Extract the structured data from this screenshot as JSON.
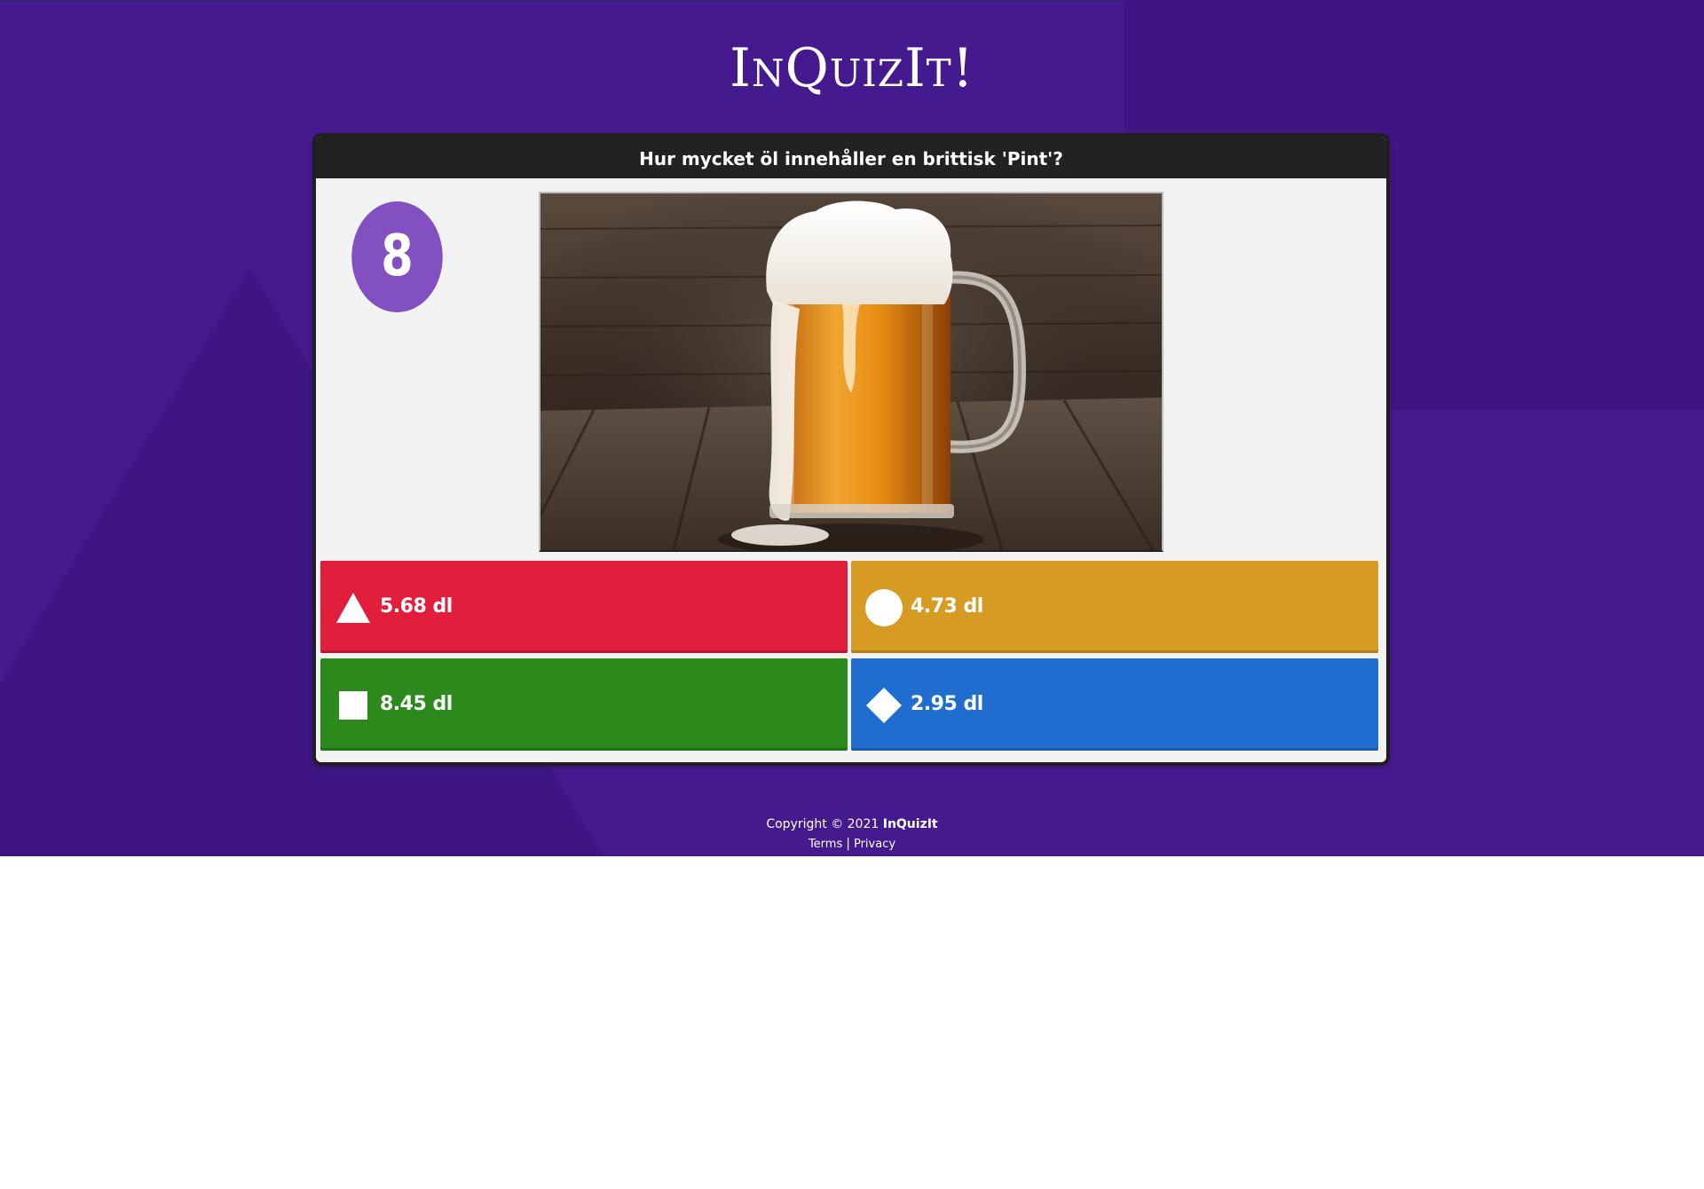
{
  "app": {
    "logo": "InQuizIt!",
    "colors": {
      "background": "#461a8f",
      "background_shade": "#3e1583",
      "card": "#f2f2f2",
      "question_bar": "#222222",
      "timer": "#8350c2"
    }
  },
  "question": {
    "text": "Hur mycket öl innehåller en brittisk 'Pint'?",
    "timer": "8",
    "image_icon": "beer-mug-photo"
  },
  "answers": [
    {
      "label": "5.68 dl",
      "shape": "triangle-icon",
      "color": "#e11e3c"
    },
    {
      "label": "4.73 dl",
      "shape": "circle-icon",
      "color": "#d79b24"
    },
    {
      "label": "8.45 dl",
      "shape": "square-icon",
      "color": "#2b8a1b"
    },
    {
      "label": "2.95 dl",
      "shape": "diamond-icon",
      "color": "#1f6ecf"
    }
  ],
  "footer": {
    "copyright": "Copyright © 2021",
    "brand": "InQuizIt",
    "terms": "Terms",
    "separator": "|",
    "privacy": "Privacy"
  }
}
